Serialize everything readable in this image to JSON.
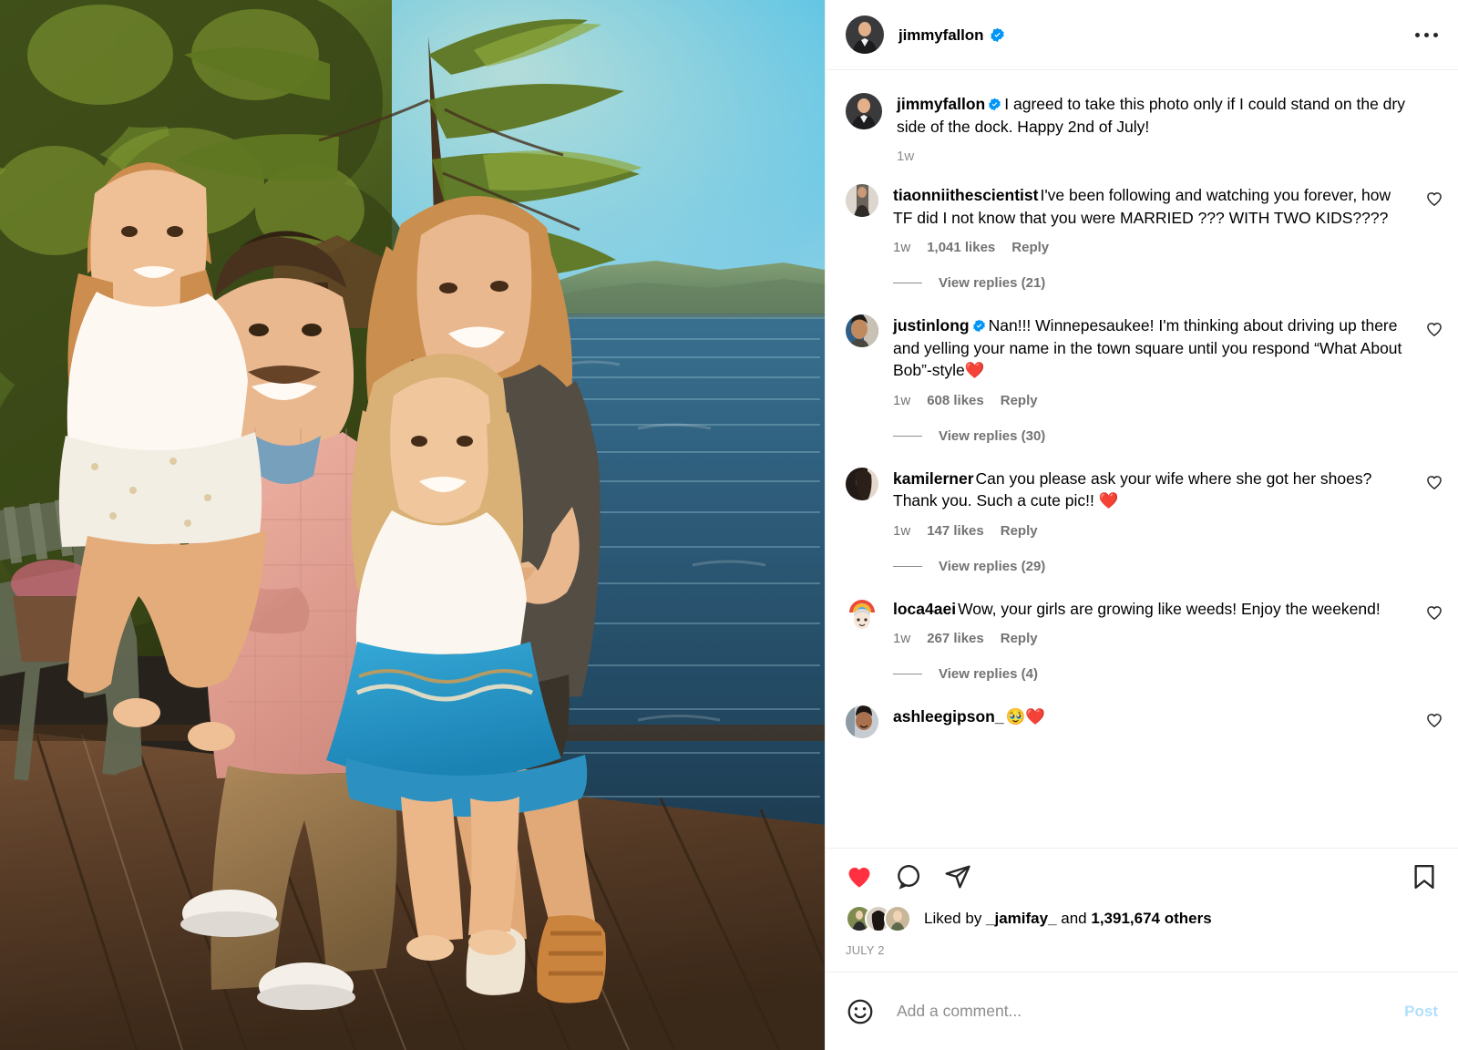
{
  "colors": {
    "verified_blue": "#0095F6",
    "like_red": "#FF3040",
    "post_disabled": "#b2dffc",
    "text_primary": "#000000",
    "text_secondary": "#737373",
    "divider": "#efefef"
  },
  "media": {
    "alt": "Family of four standing on a wooden lake dock at golden hour; man in pink checked shirt holding a young girl in a white dress, woman in dark top with arms around a second girl in a blue skirt, pine trees and blue sky on the left, lake and distant green hills behind them, Adirondack chair at far left"
  },
  "header": {
    "username": "jimmyfallon",
    "verified": true,
    "avatar_name": "jimmyfallon-avatar",
    "more_icon": "more-options-icon"
  },
  "caption": {
    "username": "jimmyfallon",
    "verified": true,
    "text": "I agreed to take this photo only if I could stand on the dry side of the dock. Happy 2nd of July!",
    "time": "1w"
  },
  "comments": [
    {
      "username": "tiaonniithescientist",
      "verified": false,
      "text": "I've been following and watching you forever, how TF did I not know that you were MARRIED ??? WITH TWO KIDS????",
      "time": "1w",
      "likes": "1,041 likes",
      "reply": "Reply",
      "view_replies": "View replies (21)"
    },
    {
      "username": "justinlong",
      "verified": true,
      "text": "Nan!!! Winnepesaukee! I'm thinking about driving up there and yelling your name in the town square until you respond “What About Bob”-style❤️",
      "time": "1w",
      "likes": "608 likes",
      "reply": "Reply",
      "view_replies": "View replies (30)"
    },
    {
      "username": "kamilerner",
      "verified": false,
      "text": "Can you please ask your wife where she got her shoes? Thank you. Such a cute pic!! ❤️",
      "time": "1w",
      "likes": "147 likes",
      "reply": "Reply",
      "view_replies": "View replies (29)"
    },
    {
      "username": "loca4aei",
      "verified": false,
      "text": "Wow, your girls are growing like weeds! Enjoy the weekend!",
      "time": "1w",
      "likes": "267 likes",
      "reply": "Reply",
      "view_replies": "View replies (4)"
    },
    {
      "username": "ashleegipson_",
      "verified": false,
      "text": "🥹❤️",
      "time": "",
      "likes": "",
      "reply": "",
      "view_replies": ""
    }
  ],
  "actions": {
    "like_icon": "heart-icon-filled",
    "comment_icon": "comment-icon",
    "share_icon": "share-icon",
    "save_icon": "bookmark-icon",
    "liked": true
  },
  "likes_summary": {
    "prefix": "Liked by ",
    "user": "_jamifay_",
    "middle": " and ",
    "count": "1,391,674",
    "suffix": " others"
  },
  "post_date": "JULY 2",
  "composer": {
    "emoji_icon": "emoji-icon",
    "placeholder": "Add a comment...",
    "value": "",
    "post_label": "Post"
  }
}
